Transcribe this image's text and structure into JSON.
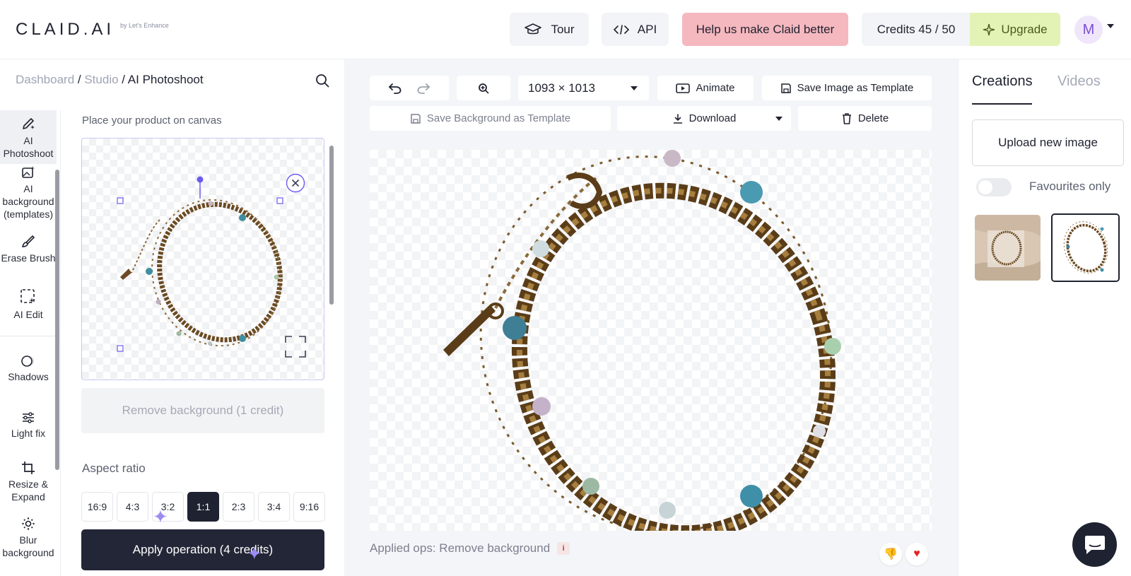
{
  "header": {
    "logo": "CLAID.AI",
    "logo_sub": "by Let's Enhance",
    "tour_label": "Tour",
    "api_label": "API",
    "feedback_label": "Help us make Claid better",
    "credits_label": "Credits 45 / 50",
    "upgrade_label": "Upgrade",
    "avatar_initial": "M"
  },
  "breadcrumb": {
    "dashboard": "Dashboard",
    "sep1": " / ",
    "studio": "Studio",
    "sep2": " / ",
    "current": "AI Photoshoot"
  },
  "tools": [
    {
      "label": "AI Photoshoot",
      "icon": "pen-sparkle-icon"
    },
    {
      "label": "AI background (templates)",
      "icon": "image-sparkle-icon"
    },
    {
      "label": "Erase Brush",
      "icon": "brush-icon"
    },
    {
      "label": "AI Edit",
      "icon": "selection-sparkle-icon"
    },
    {
      "label": "Shadows",
      "icon": "shadow-icon"
    },
    {
      "label": "Light fix",
      "icon": "sliders-icon"
    },
    {
      "label": "Resize & Expand",
      "icon": "crop-icon"
    },
    {
      "label": "Blur background",
      "icon": "blur-icon"
    }
  ],
  "panel": {
    "place_label": "Place your product on canvas",
    "remove_bg_label": "Remove background (1 credit)",
    "aspect_label": "Aspect ratio",
    "ratios": [
      "16:9",
      "4:3",
      "3:2",
      "1:1",
      "2:3",
      "3:4",
      "9:16"
    ],
    "selected_ratio": "1:1",
    "apply_label": "Apply operation (4 credits)"
  },
  "editor": {
    "size_label": "1093 × 1013",
    "animate_label": "Animate",
    "save_image_template_label": "Save Image as Template",
    "save_bg_template_label": "Save Background as Template",
    "download_label": "Download",
    "delete_label": "Delete",
    "applied_ops": "Applied ops: Remove background",
    "info_badge": "i"
  },
  "right": {
    "tab_creations": "Creations",
    "tab_videos": "Videos",
    "upload_label": "Upload new image",
    "favourites_label": "Favourites only"
  },
  "colors": {
    "accent_purple": "#6b5cf0",
    "feedback_bg": "#f5b8bf",
    "upgrade_bg": "#e2f3b5",
    "dark": "#1f2230"
  }
}
